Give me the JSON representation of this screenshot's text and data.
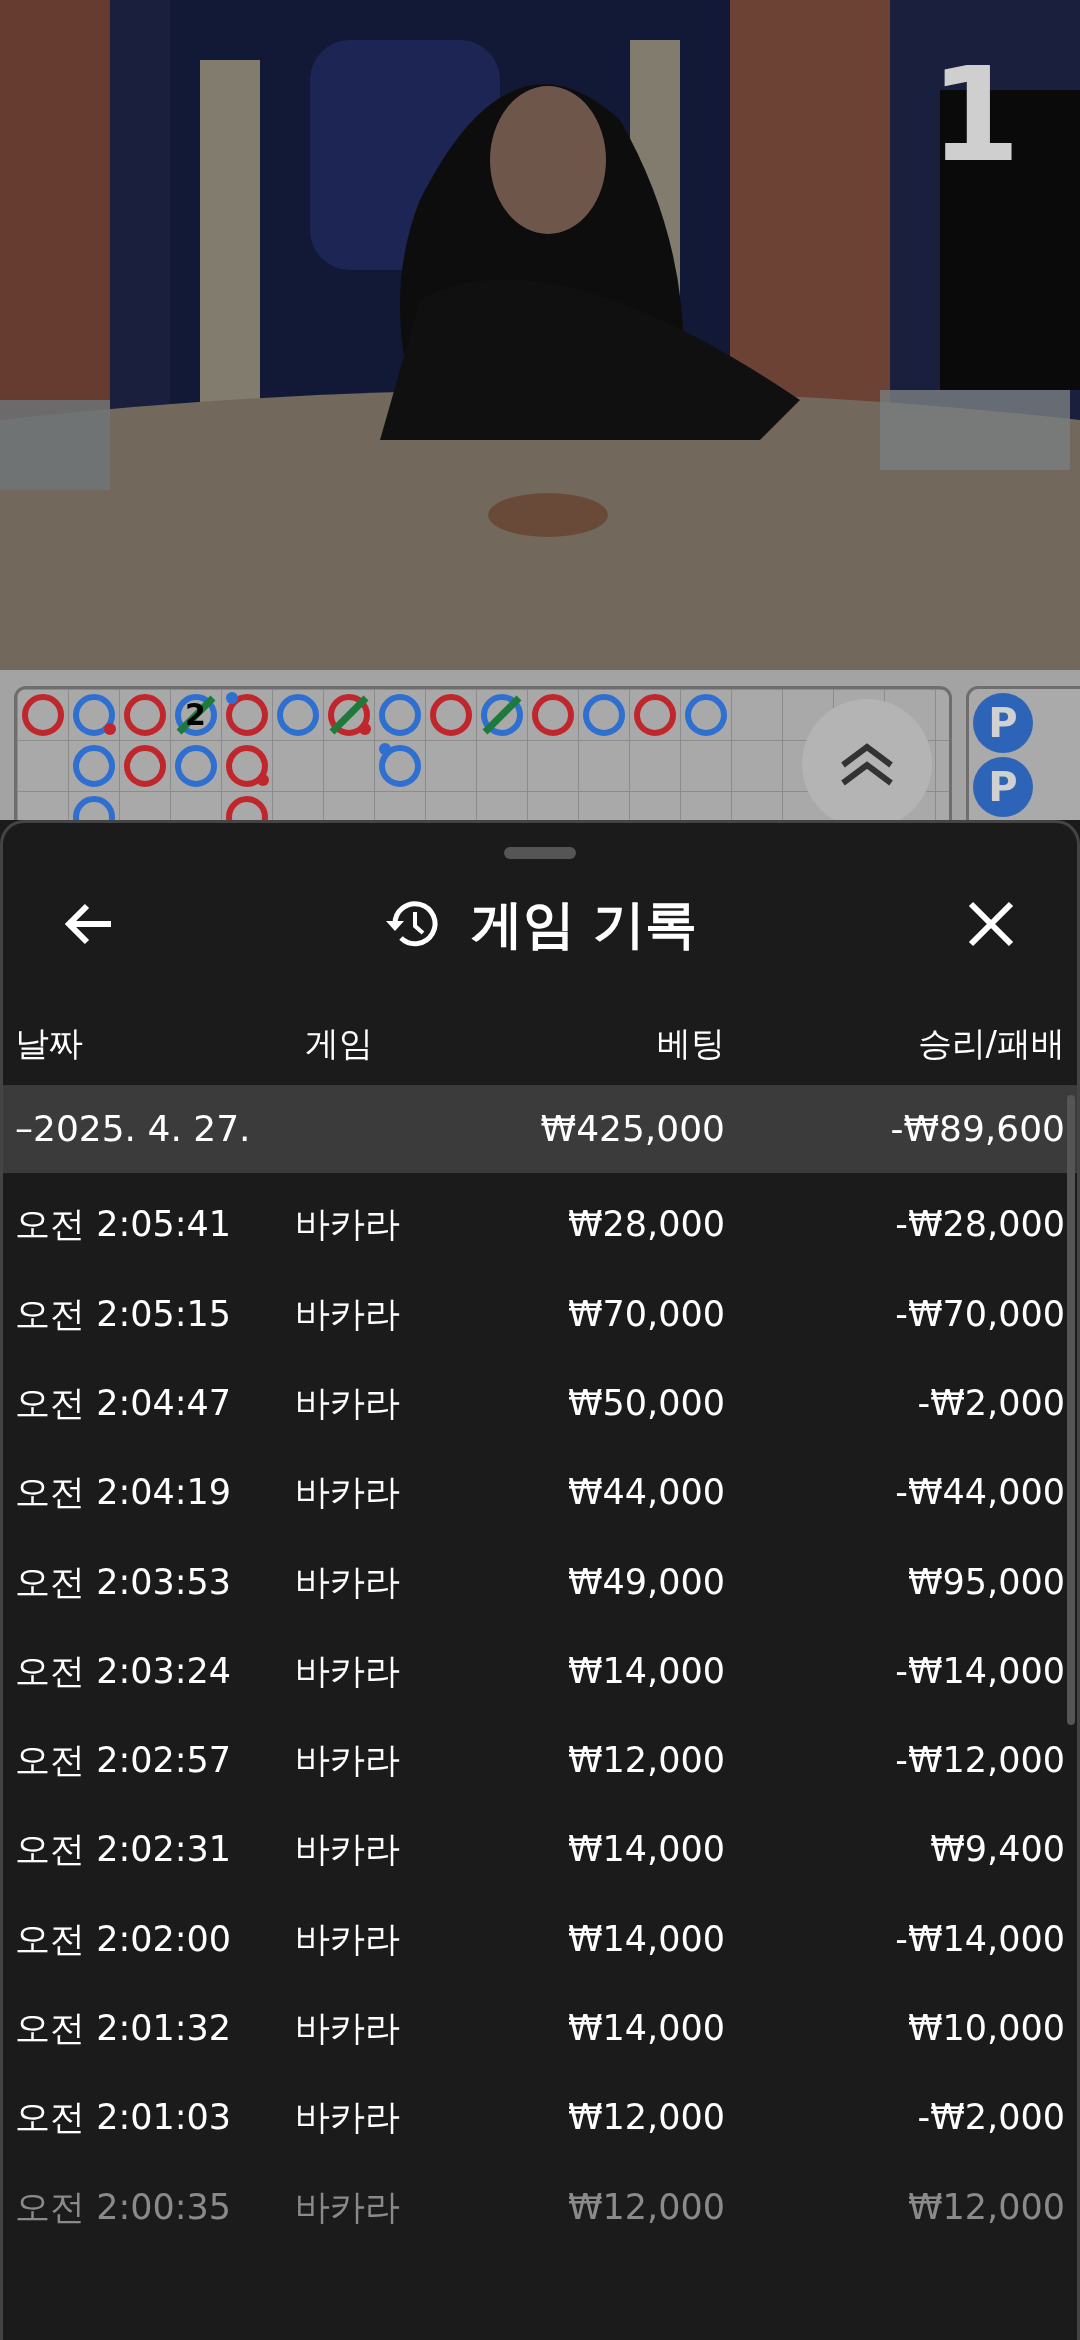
{
  "video": {
    "kind": "picture",
    "countdown": "1"
  },
  "roadmap": {
    "columns": [
      [
        {
          "color": "#c0272d"
        }
      ],
      [
        {
          "color": "#2f6fd0",
          "dot": {
            "color": "#c0272d"
          }
        },
        {
          "color": "#2f6fd0"
        },
        {
          "color": "#2f6fd0"
        }
      ],
      [
        {
          "color": "#c0272d"
        },
        {
          "color": "#c0272d"
        }
      ],
      [
        {
          "color": "#2f6fd0",
          "tie": true,
          "label": "2"
        },
        {
          "color": "#2f6fd0"
        }
      ],
      [
        {
          "color": "#c0272d",
          "dot_top": {
            "color": "#2f6fd0"
          }
        },
        {
          "color": "#c0272d",
          "dot": {
            "color": "#c0272d"
          }
        },
        {
          "color": "#c0272d"
        }
      ],
      [
        {
          "color": "#2f6fd0"
        }
      ],
      [
        {
          "color": "#c0272d",
          "tie": true,
          "dot": {
            "color": "#c0272d"
          }
        }
      ],
      [
        {
          "color": "#2f6fd0"
        },
        {
          "color": "#2f6fd0",
          "dot_top": {
            "color": "#2f6fd0"
          }
        }
      ],
      [
        {
          "color": "#c0272d"
        }
      ],
      [
        {
          "color": "#2f6fd0",
          "tie": true
        }
      ],
      [
        {
          "color": "#c0272d"
        }
      ],
      [
        {
          "color": "#2f6fd0"
        }
      ],
      [
        {
          "color": "#c0272d"
        }
      ],
      [
        {
          "color": "#2f6fd0"
        }
      ]
    ]
  },
  "bead_plate": [
    {
      "label": "P",
      "color": "#2e64b8"
    },
    {
      "label": "P",
      "color": "#2e64b8"
    }
  ],
  "sheet": {
    "title": "게임 기록",
    "columns": [
      "날짜",
      "게임",
      "베팅",
      "승리/패배"
    ],
    "summary": {
      "date": "–2025. 4. 27.",
      "bet": "₩425,000",
      "result": "-₩89,600"
    },
    "rows": [
      {
        "time": "오전 2:05:41",
        "game": "바카라",
        "bet": "₩28,000",
        "result": "-₩28,000",
        "dimmed": false
      },
      {
        "time": "오전 2:05:15",
        "game": "바카라",
        "bet": "₩70,000",
        "result": "-₩70,000",
        "dimmed": false
      },
      {
        "time": "오전 2:04:47",
        "game": "바카라",
        "bet": "₩50,000",
        "result": "-₩2,000",
        "dimmed": false
      },
      {
        "time": "오전 2:04:19",
        "game": "바카라",
        "bet": "₩44,000",
        "result": "-₩44,000",
        "dimmed": false
      },
      {
        "time": "오전 2:03:53",
        "game": "바카라",
        "bet": "₩49,000",
        "result": "₩95,000",
        "dimmed": false
      },
      {
        "time": "오전 2:03:24",
        "game": "바카라",
        "bet": "₩14,000",
        "result": "-₩14,000",
        "dimmed": false
      },
      {
        "time": "오전 2:02:57",
        "game": "바카라",
        "bet": "₩12,000",
        "result": "-₩12,000",
        "dimmed": false
      },
      {
        "time": "오전 2:02:31",
        "game": "바카라",
        "bet": "₩14,000",
        "result": "₩9,400",
        "dimmed": false
      },
      {
        "time": "오전 2:02:00",
        "game": "바카라",
        "bet": "₩14,000",
        "result": "-₩14,000",
        "dimmed": false
      },
      {
        "time": "오전 2:01:32",
        "game": "바카라",
        "bet": "₩14,000",
        "result": "₩10,000",
        "dimmed": false
      },
      {
        "time": "오전 2:01:03",
        "game": "바카라",
        "bet": "₩12,000",
        "result": "-₩2,000",
        "dimmed": false
      },
      {
        "time": "오전 2:00:35",
        "game": "바카라",
        "bet": "₩12,000",
        "result": "₩12,000",
        "dimmed": true
      }
    ]
  }
}
